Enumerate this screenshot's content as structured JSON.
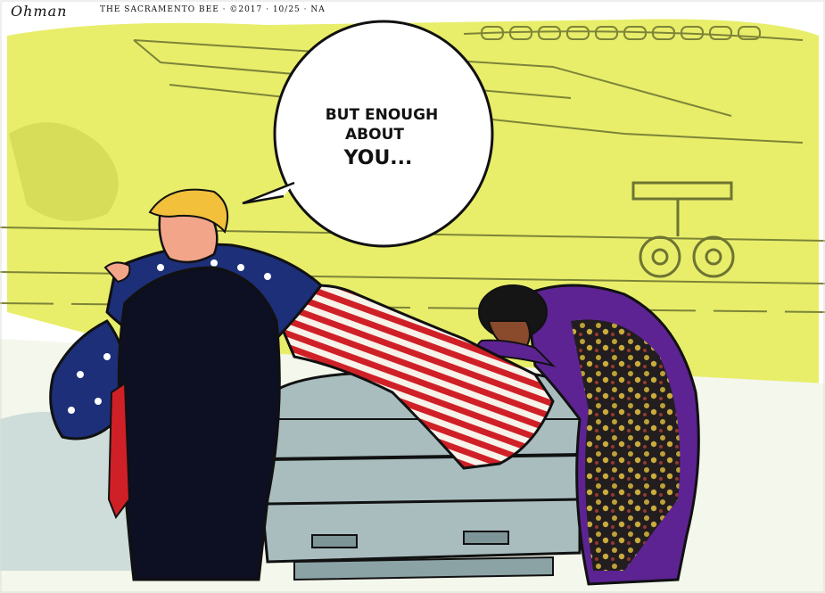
{
  "credit": {
    "signature": "Ohman",
    "line": "THE SACRAMENTO BEE · ©2017 · 10/25 · NA"
  },
  "speech_bubble": {
    "line1": "BUT ENOUGH",
    "line2": "ABOUT",
    "line3": "YOU..."
  },
  "colors": {
    "sky": "#e8ee6a",
    "ground": "#f4f7ec",
    "suit": "#0d0f22",
    "flag_blue": "#1d2f78",
    "flag_red": "#d02027",
    "casket": "#a9bdbf",
    "dress": "#5d2393",
    "dress_pattern": "#c9b02c",
    "hair": "#f2c03a",
    "skin": "#f3a58a"
  }
}
